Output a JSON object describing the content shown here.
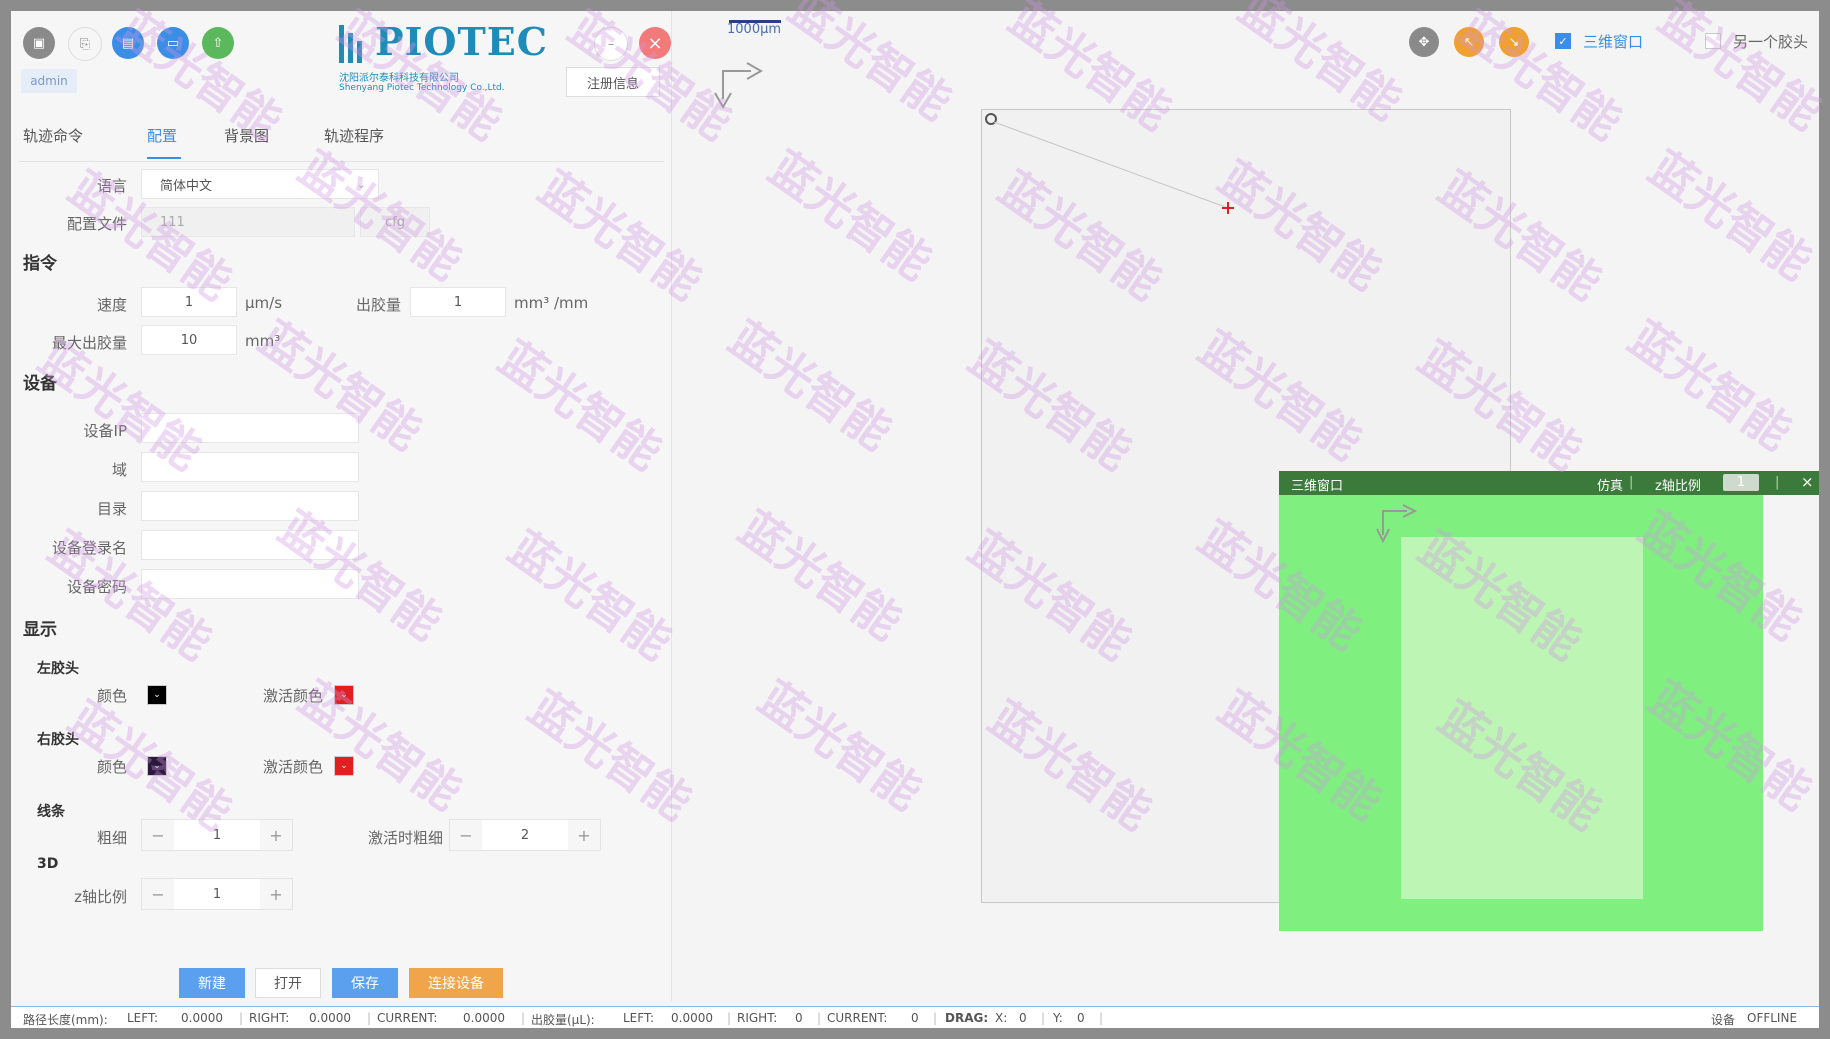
{
  "toolbar": {
    "buttons": [
      {
        "icon": "save-icon",
        "glyph": "▣",
        "color": "#8a8a8a"
      },
      {
        "icon": "save-as-icon",
        "glyph": "⎘",
        "color": "#ffffff"
      },
      {
        "icon": "open-file-icon",
        "glyph": "▤",
        "color": "#3a8ee6"
      },
      {
        "icon": "folder-icon",
        "glyph": "▭",
        "color": "#3a8ee6"
      },
      {
        "icon": "upload-icon",
        "glyph": "⇧",
        "color": "#5cb85c"
      }
    ],
    "user": "admin",
    "minimize_glyph": "–",
    "close_glyph": "×"
  },
  "logo": {
    "text": "PIOTEC",
    "subtitle_cn": "沈阳派尔泰科科技有限公司",
    "subtitle_en": "Shenyang Piotec Technology Co.,Ltd."
  },
  "register_label": "注册信息",
  "tabs": [
    {
      "label": "轨迹命令",
      "active": false
    },
    {
      "label": "配置",
      "active": true
    },
    {
      "label": "背景图",
      "active": false
    },
    {
      "label": "轨迹程序",
      "active": false
    }
  ],
  "config": {
    "language_label": "语言",
    "language_value": "简体中文",
    "config_file_label": "配置文件",
    "config_file_value": "111",
    "config_file_ext": "cfg"
  },
  "command": {
    "section": "指令",
    "speed_label": "速度",
    "speed_value": "1",
    "speed_unit": "μm/s",
    "glue_label": "出胶量",
    "glue_value": "1",
    "glue_unit": "mm³ /mm",
    "max_glue_label": "最大出胶量",
    "max_glue_value": "10",
    "max_glue_unit": "mm³"
  },
  "device": {
    "section": "设备",
    "ip_label": "设备IP",
    "domain_label": "域",
    "dir_label": "目录",
    "login_label": "设备登录名",
    "password_label": "设备密码",
    "ip_value": "",
    "domain_value": "",
    "dir_value": "",
    "login_value": "",
    "password_value": ""
  },
  "display": {
    "section": "显示",
    "left_head": "左胶头",
    "right_head": "右胶头",
    "color_label": "颜色",
    "active_color_label": "激活颜色",
    "left_color": "#000000",
    "left_active_color": "#e02020",
    "right_color": "#2a1a3a",
    "right_active_color": "#e02020",
    "line_section": "线条",
    "thickness_label": "粗细",
    "thickness_value": "1",
    "active_thickness_label": "激活时粗细",
    "active_thickness_value": "2",
    "section_3d": "3D",
    "z_ratio_label": "z轴比例",
    "z_ratio_value": "1"
  },
  "actions": {
    "new": "新建",
    "open": "打开",
    "save": "保存",
    "connect": "连接设备"
  },
  "canvas": {
    "scale_label": "1000μm",
    "right_buttons": [
      {
        "icon": "move-icon",
        "glyph": "✥",
        "color": "#8a8a8a"
      },
      {
        "icon": "zoom-in-icon",
        "glyph": "↖",
        "color": "#f0a030"
      },
      {
        "icon": "zoom-out-icon",
        "glyph": "↘",
        "color": "#f0a030"
      }
    ],
    "checkbox_3d_label": "三维窗口",
    "checkbox_3d_checked": true,
    "checkbox_other_label": "另一个胶头",
    "checkbox_other_checked": false
  },
  "win3d": {
    "title": "三维窗口",
    "simulate_label": "仿真",
    "z_ratio_label": "z轴比例",
    "z_ratio_value": "1",
    "close_glyph": "×"
  },
  "status": {
    "path_label": "路径长度(mm):",
    "left_label": "LEFT:",
    "left_path": "0.0000",
    "right_label": "RIGHT:",
    "right_path": "0.0000",
    "current_label": "CURRENT:",
    "current_path": "0.0000",
    "glue_label": "出胶量(μL):",
    "glue_left_label": "LEFT:",
    "glue_left": "0.0000",
    "glue_right_label": "RIGHT:",
    "glue_right": "0",
    "glue_current_label": "CURRENT:",
    "glue_current": "0",
    "drag_label": "DRAG:",
    "x_label": "X:",
    "x_value": "0",
    "y_label": "Y:",
    "y_value": "0",
    "device_label": "设备",
    "device_status": "OFFLINE"
  },
  "watermark": "蓝光智能"
}
